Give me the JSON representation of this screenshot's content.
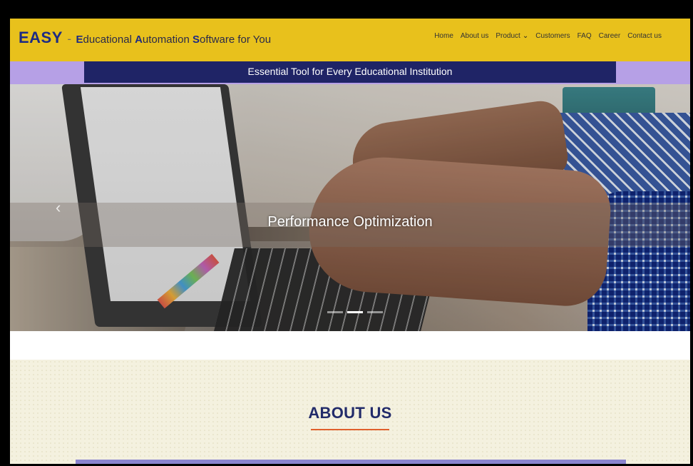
{
  "header": {
    "brand_easy": "EASY",
    "brand_dash": "-",
    "tagline_parts": [
      "E",
      "ducational ",
      "A",
      "utomation ",
      "S",
      "oftware for You"
    ],
    "nav": [
      {
        "label": "Home"
      },
      {
        "label": "About us"
      },
      {
        "label": "Product",
        "has_dropdown": true
      },
      {
        "label": "Customers"
      },
      {
        "label": "FAQ"
      },
      {
        "label": "Career"
      },
      {
        "label": "Contact us"
      }
    ]
  },
  "banner": {
    "text": "Essential Tool for Every Educational Institution"
  },
  "hero": {
    "caption": "Performance Optimization",
    "prev_icon": "‹",
    "slide_count": 3,
    "active_slide": 2
  },
  "about": {
    "title": "ABOUT US"
  },
  "colors": {
    "header_bg": "#e8c11c",
    "brand_blue": "#1d2b84",
    "banner_bg": "#1f2466",
    "banner_strip": "#b6a0e6",
    "about_bg": "#f4f1df",
    "accent_orange": "#e0602c"
  }
}
